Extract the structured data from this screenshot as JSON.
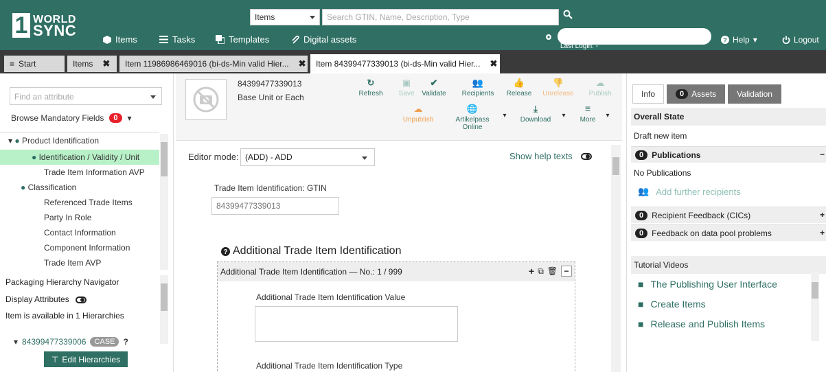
{
  "colors": {
    "brand": "#2f6f64",
    "tab_bar": "#3a3a3a",
    "selected_tree": "#b8f0c8",
    "badge_red": "#e8202a"
  },
  "logo": {
    "line1": "WORLD",
    "line2": "SYNC"
  },
  "search": {
    "type_value": "Items",
    "placeholder": "Search GTIN, Name, Description, Type"
  },
  "nav": {
    "items": "Items",
    "tasks": "Tasks",
    "templates": "Templates",
    "digital_assets": "Digital assets",
    "last_login": "Last Login: -",
    "help": "Help",
    "logout": "Logout"
  },
  "tabs": [
    {
      "label": "Start"
    },
    {
      "label": "Items"
    },
    {
      "label": "Item 11986986469016 (bi-ds-Min valid Hier..."
    },
    {
      "label": "Item 84399477339013 (bi-ds-Min valid Hier..."
    }
  ],
  "left": {
    "attr_placeholder": "Find an attribute",
    "browse_label": "Browse Mandatory Fields",
    "browse_count": "0",
    "tree": [
      "Product Identification",
      "Identification / Validity / Unit",
      "Trade Item Information AVP",
      "Classification",
      "Referenced Trade Items",
      "Party In Role",
      "Contact Information",
      "Component Information",
      "Trade Item AVP"
    ],
    "packaging_title": "Packaging Hierarchy Navigator",
    "display_attributes": "Display Attributes",
    "available": "Item is available in 1 Hierarchies",
    "hier_gtin": "84399477339006",
    "hier_case": "CASE",
    "edit_hierarchies": "Edit Hierarchies"
  },
  "item": {
    "gtin": "84399477339013",
    "unit": "Base Unit or Each"
  },
  "toolbar": {
    "refresh": "Refresh",
    "save": "Save",
    "validate": "Validate",
    "recipients": "Recipients",
    "release": "Release",
    "unrelease": "Unrelease",
    "publish": "Publish",
    "unpublish": "Unpublish",
    "artikelpass_1": "Artikelpass",
    "artikelpass_2": "Online",
    "download": "Download",
    "more": "More"
  },
  "form": {
    "editor_mode_label": "Editor mode:",
    "editor_mode_value": "(ADD) - ADD",
    "show_help": "Show help texts",
    "gtin_label": "Trade Item Identification: GTIN",
    "gtin_value": "84399477339013",
    "section_title": "Additional Trade Item Identification",
    "section_head": "Additional Trade Item Identification — No.: 1 / 999",
    "value_label": "Additional Trade Item Identification Value",
    "type_label": "Additional Trade Item Identification Type"
  },
  "right": {
    "tab_info": "Info",
    "tab_assets_count": "0",
    "tab_assets": "Assets",
    "tab_validation": "Validation",
    "overall_state": "Overall State",
    "draft": "Draft new item",
    "publications_count": "0",
    "publications": "Publications",
    "no_publications": "No Publications",
    "add_recipients": "Add further recipients",
    "feedback_count": "0",
    "feedback": "Recipient Feedback (CICs)",
    "pool_count": "0",
    "pool": "Feedback on data pool problems",
    "tutorial": "Tutorial Videos",
    "videos": [
      "The Publishing User Interface",
      "Create Items",
      "Release and Publish Items"
    ]
  }
}
